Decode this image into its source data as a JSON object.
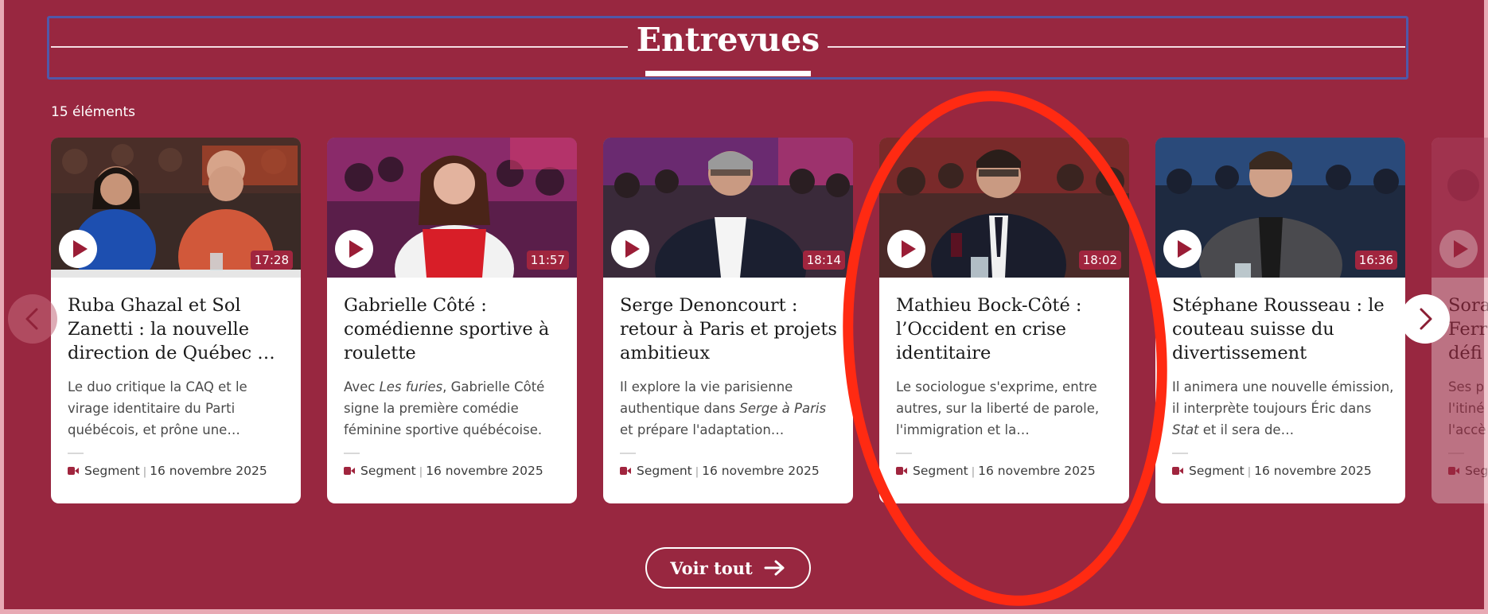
{
  "section": {
    "title": "Entrevues",
    "count_label": "15 éléments",
    "see_all_label": "Voir tout"
  },
  "colors": {
    "background": "#982740",
    "accent": "#a0253e",
    "frame_outline": "#5058a8",
    "annotation": "#ff2a12"
  },
  "cards": [
    {
      "title": "Ruba Ghazal et Sol Zanetti : la nouvelle direction de Québec …",
      "description": "Le duo critique la CAQ et le virage identitaire du Parti québécois, et prône une…",
      "duration": "17:28",
      "type": "Segment",
      "date": "16 novembre 2025"
    },
    {
      "title": "Gabrielle Côté : comédienne sportive à roulette",
      "description_before": "Avec ",
      "description_italic": "Les furies",
      "description_after": ", Gabrielle Côté signe la première comédie féminine sportive québécoise.",
      "duration": "11:57",
      "type": "Segment",
      "date": "16 novembre 2025"
    },
    {
      "title": "Serge Denoncourt : retour à Paris et projets ambitieux",
      "description_before": "Il explore la vie parisienne authentique dans ",
      "description_italic": "Serge à Paris",
      "description_after": " et prépare l'adaptation…",
      "duration": "18:14",
      "type": "Segment",
      "date": "16 novembre 2025"
    },
    {
      "title": "Mathieu Bock-Côté : l’Occident en crise identitaire",
      "description": "Le sociologue s'exprime, entre autres, sur la liberté de parole, l'immigration et la…",
      "duration": "18:02",
      "type": "Segment",
      "date": "16 novembre 2025"
    },
    {
      "title": "Stéphane Rousseau : le couteau suisse du divertissement",
      "description_before": "Il animera une nouvelle émission, il interprète toujours Éric dans ",
      "description_italic": "Stat",
      "description_after": " et il sera de…",
      "duration": "16:36",
      "type": "Segment",
      "date": "16 novembre 2025"
    },
    {
      "title": "Sora Ferr défi",
      "description": "Ses p l'itiné l'accè",
      "type": "Seg"
    }
  ],
  "icons": {
    "play": "play-icon",
    "video": "video-camera-icon",
    "prev": "chevron-left-icon",
    "next": "chevron-right-icon",
    "see_all": "arrow-right-icon"
  }
}
